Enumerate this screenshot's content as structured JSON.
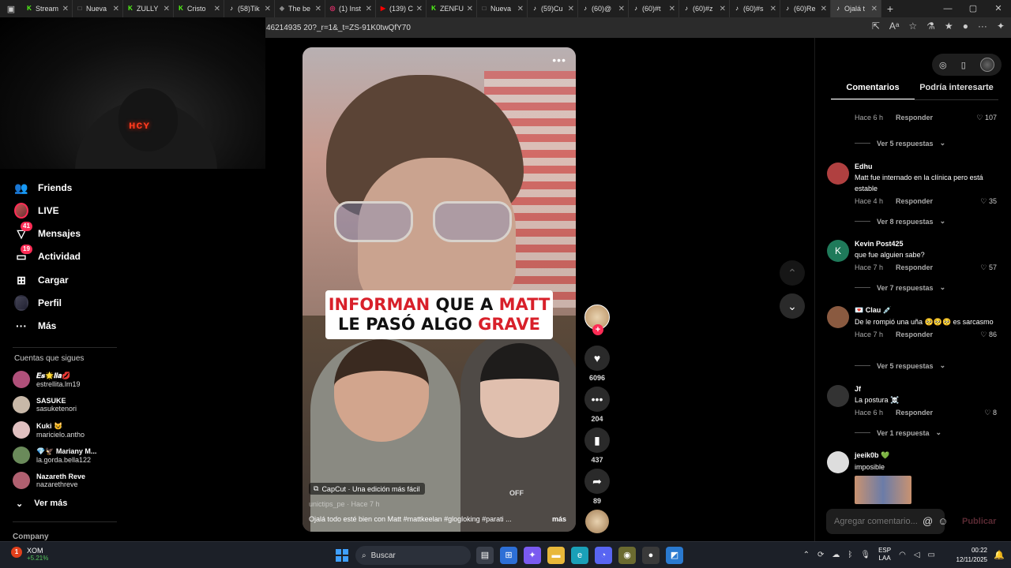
{
  "browser": {
    "tabs": [
      {
        "title": "Stream",
        "fav": "K",
        "color": "#53fc18"
      },
      {
        "title": "Nueva",
        "fav": "□",
        "color": "#888888"
      },
      {
        "title": "ZULLY",
        "fav": "K",
        "color": "#53fc18"
      },
      {
        "title": "Cristo",
        "fav": "K",
        "color": "#53fc18"
      },
      {
        "title": "(58)Tik",
        "fav": "♪",
        "color": "#ffffff"
      },
      {
        "title": "The be",
        "fav": "◆",
        "color": "#888888"
      },
      {
        "title": "(1) Inst",
        "fav": "◎",
        "color": "#e1306c"
      },
      {
        "title": "(139) C",
        "fav": "▶",
        "color": "#ff0000"
      },
      {
        "title": "ZENFU",
        "fav": "K",
        "color": "#53fc18"
      },
      {
        "title": "Nueva",
        "fav": "□",
        "color": "#888888"
      },
      {
        "title": "(59)Cu",
        "fav": "♪",
        "color": "#ffffff"
      },
      {
        "title": "(60)@",
        "fav": "♪",
        "color": "#ffffff"
      },
      {
        "title": "(60)#t",
        "fav": "♪",
        "color": "#ffffff"
      },
      {
        "title": "(60)#z",
        "fav": "♪",
        "color": "#ffffff"
      },
      {
        "title": "(60)#s",
        "fav": "♪",
        "color": "#ffffff"
      },
      {
        "title": "(60)Re",
        "fav": "♪",
        "color": "#ffffff"
      },
      {
        "title": "Ojalá t",
        "fav": "♪",
        "color": "#ffffff",
        "active": true
      }
    ],
    "url": "46214935 20?_r=1&_t=ZS-91K0twQfY70"
  },
  "sidebar": {
    "nav": [
      {
        "label": "Friends",
        "icon": "friends-icon",
        "glyph": "👥"
      },
      {
        "label": "LIVE",
        "icon": "live-icon",
        "glyph": ""
      },
      {
        "label": "Mensajes",
        "icon": "messages-icon",
        "glyph": "▽",
        "badge": "41"
      },
      {
        "label": "Actividad",
        "icon": "activity-icon",
        "glyph": "▭",
        "badge": "19"
      },
      {
        "label": "Cargar",
        "icon": "upload-icon",
        "glyph": "⊞"
      },
      {
        "label": "Perfil",
        "icon": "profile-icon",
        "glyph": ""
      },
      {
        "label": "Más",
        "icon": "more-icon",
        "glyph": "···"
      }
    ],
    "following_title": "Cuentas que sigues",
    "following": [
      {
        "name": "𝑬𝒔🌟𝒍𝒍𝒂💋",
        "user": "estrellita.lm19",
        "color": "#b0507a"
      },
      {
        "name": "SASUKE",
        "user": "sasuketenori",
        "color": "#c8b8a8"
      },
      {
        "name": "Kuki 😺",
        "user": "maricielo.antho",
        "color": "#e0c0c0"
      },
      {
        "name": "💎🦅 Mariany M...",
        "user": "la.gorda.bella122",
        "color": "#6a8a5a"
      },
      {
        "name": "Nazareth Reve",
        "user": "nazarethreve",
        "color": "#b06070"
      }
    ],
    "see_more": "Ver más",
    "company": "Company"
  },
  "video": {
    "caption_line1": [
      "INFORMAN ",
      "QUE A ",
      "MATT"
    ],
    "caption_line2": [
      "LE PASÓ ALGO ",
      "GRAVE"
    ],
    "capcut": "CapCut · Una edición más fácil",
    "author": "unictips_pe · Hace 7 h",
    "description": "Ojalá todo esté bien con Matt #mattkeelan #glogloking #parati ...",
    "more": "más",
    "shirt_text": "OFF",
    "likes": "6096",
    "comments": "204",
    "saves": "437",
    "shares": "89"
  },
  "panel": {
    "tabs": [
      "Comentarios",
      "Podría interesarte"
    ],
    "comments": [
      {
        "user": "",
        "text": "",
        "time": "Hace 6 h",
        "reply": "Responder",
        "likes": "107",
        "replies": "Ver 5 respuestas",
        "color": "#444444"
      },
      {
        "user": "Edhu",
        "text": "Matt fue internado en la clínica pero está estable",
        "time": "Hace 4 h",
        "reply": "Responder",
        "likes": "35",
        "replies": "Ver 8 respuestas",
        "color": "#b04040"
      },
      {
        "user": "Kevin Post425",
        "text": "que fue alguien sabe?",
        "time": "Hace 7 h",
        "reply": "Responder",
        "likes": "57",
        "replies": "Ver 7 respuestas",
        "color": "#1f7a5a",
        "initial": "K"
      },
      {
        "user": "💌 Clau 💉",
        "text": "De le rompió una uña 🥺🥺🥺 es sarcasmo",
        "time": "Hace 7 h",
        "reply": "Responder",
        "likes": "86",
        "replies": "Ver 5 respuestas",
        "color": "#8a5a40"
      },
      {
        "user": "Jf",
        "text": "La postura ☠️",
        "time": "Hace 6 h",
        "reply": "Responder",
        "likes": "8",
        "replies": "Ver 1 respuesta",
        "color": "#333333"
      },
      {
        "user": "jeeik0b 💚",
        "text": "imposible",
        "time": "",
        "reply": "",
        "likes": "",
        "replies": "",
        "color": "#dddddd"
      }
    ],
    "input_placeholder": "Agregar comentario...",
    "publish": "Publicar"
  },
  "taskbar": {
    "stock_name": "XOM",
    "stock_change": "+5.21%",
    "search": "Buscar",
    "lang1": "ESP",
    "lang2": "LAA",
    "time": "00:22",
    "date": "12/11/2025"
  }
}
